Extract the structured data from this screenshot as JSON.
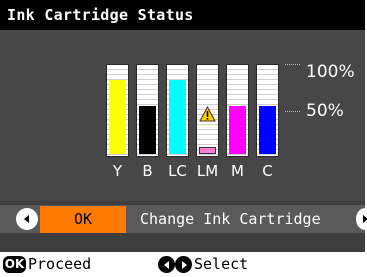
{
  "title": "Ink Cartridge Status",
  "scale": {
    "top_label": "100%",
    "mid_label": "50%"
  },
  "tanks": [
    {
      "label": "Y",
      "level": 0.83,
      "color": "#ffff00",
      "warning": false
    },
    {
      "label": "B",
      "level": 0.54,
      "color": "#000000",
      "warning": false
    },
    {
      "label": "LC",
      "level": 0.83,
      "color": "#00ffff",
      "warning": false
    },
    {
      "label": "LM",
      "level": 0.06,
      "color": "#ff7fd4",
      "warning": true
    },
    {
      "label": "M",
      "level": 0.54,
      "color": "#ff00ff",
      "warning": false
    },
    {
      "label": "C",
      "level": 0.54,
      "color": "#0000ff",
      "warning": false
    }
  ],
  "action": {
    "button_label": "OK",
    "description": "Change Ink Cartridge",
    "accent": "#ff7a00"
  },
  "footer": {
    "ok_badge": "OK",
    "proceed": "Proceed",
    "select": "Select"
  },
  "icons": {
    "left": "arrow-left-icon",
    "right": "arrow-right-icon",
    "warning": "warning-icon"
  }
}
